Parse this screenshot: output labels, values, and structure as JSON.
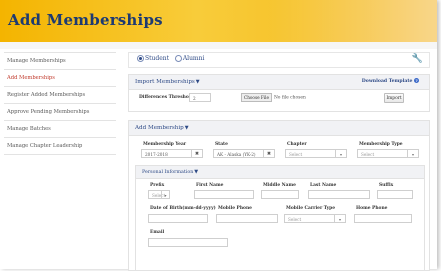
{
  "header": {
    "title": "Add Memberships"
  },
  "sidebar": {
    "items": [
      {
        "label": "Manage Memberships",
        "active": false
      },
      {
        "label": "Add Memberships",
        "active": true
      },
      {
        "label": "Register Added Memberships",
        "active": false
      },
      {
        "label": "Approve Pending Memberships",
        "active": false
      },
      {
        "label": "Manage Batches",
        "active": false
      },
      {
        "label": "Manage Chapter Leadership",
        "active": false
      }
    ]
  },
  "topbar": {
    "student_label": "Student",
    "alumni_label": "Alumni",
    "selected": "Student",
    "wrench_icon": "wrench-icon"
  },
  "import": {
    "title": "Import Memberships",
    "download_template": "Download Template",
    "differences_label": "Differences Threshold",
    "differences_value": "2",
    "choose_file": "Choose File",
    "no_file": "No file chosen",
    "import_button": "Import"
  },
  "add": {
    "title": "Add Membership",
    "fields": {
      "membership_year": {
        "label": "Membership Year",
        "value": "2017-2018"
      },
      "state": {
        "label": "State",
        "value": "AK - Alaska (YK-2)"
      },
      "chapter": {
        "label": "Chapter",
        "value": "Select"
      },
      "membership_type": {
        "label": "Membership Type",
        "value": "Select"
      }
    }
  },
  "personal": {
    "title": "Personal Information",
    "prefix": {
      "label": "Prefix",
      "value": "Select"
    },
    "first_name": {
      "label": "First Name",
      "value": ""
    },
    "middle_name": {
      "label": "Middle Name",
      "value": ""
    },
    "last_name": {
      "label": "Last Name",
      "value": ""
    },
    "suffix": {
      "label": "Suffix",
      "value": ""
    },
    "dob": {
      "label": "Date of Birth(mm-dd-yyyy)",
      "value": ""
    },
    "mobile_phone": {
      "label": "Mobile Phone",
      "value": ""
    },
    "mobile_carrier": {
      "label": "Mobile Carrier Type",
      "value": "Select"
    },
    "home_phone": {
      "label": "Home Phone",
      "value": ""
    },
    "email": {
      "label": "Email",
      "value": ""
    }
  },
  "colors": {
    "header_gold": "#f4b400",
    "title_navy": "#1d3a72",
    "link_blue": "#2e4a86",
    "active_red": "#c0392b"
  }
}
